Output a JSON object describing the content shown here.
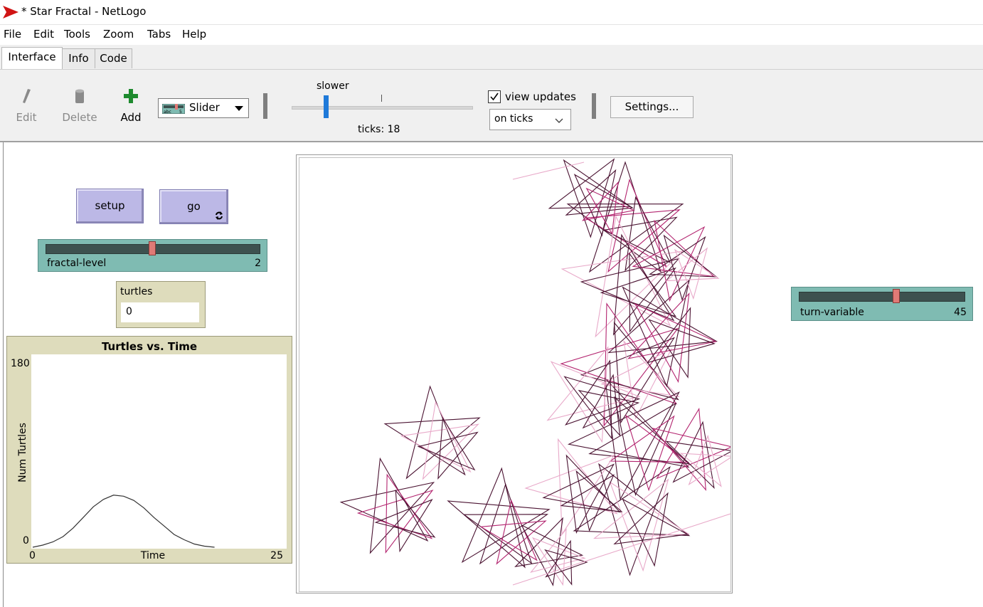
{
  "window": {
    "title": "* Star Fractal - NetLogo"
  },
  "menu": [
    "File",
    "Edit",
    "Tools",
    "Zoom",
    "Tabs",
    "Help"
  ],
  "tabs": [
    "Interface",
    "Info",
    "Code"
  ],
  "toolbar": {
    "edit_label": "Edit",
    "delete_label": "Delete",
    "add_label": "Add",
    "widget_type": "Slider",
    "speed_label": "slower",
    "ticks_text": "ticks: 18",
    "view_updates_label": "view updates",
    "view_updates_checked": true,
    "update_mode": "on ticks",
    "settings_label": "Settings..."
  },
  "buttons": {
    "setup": "setup",
    "go": "go"
  },
  "sliders": {
    "fractal_level": {
      "name": "fractal-level",
      "value": "2"
    },
    "turn_variable": {
      "name": "turn-variable",
      "value": "45"
    }
  },
  "monitor": {
    "name": "turtles",
    "value": "0"
  },
  "plot": {
    "title": "Turtles vs. Time",
    "xlabel": "Time",
    "ylabel": "Num Turtles",
    "xmin": "0",
    "xmax": "25",
    "ymin": "0",
    "ymax": "180"
  },
  "chart_data": {
    "type": "line",
    "title": "Turtles vs. Time",
    "xlabel": "Time",
    "ylabel": "Num Turtles",
    "xlim": [
      0,
      25
    ],
    "ylim": [
      0,
      180
    ],
    "series": [
      {
        "x": [
          0,
          1,
          2,
          3,
          4,
          5,
          6,
          7,
          8,
          9,
          10,
          11,
          12,
          13,
          14,
          15,
          16,
          17,
          18
        ],
        "values": [
          0,
          2,
          5,
          10,
          18,
          28,
          38,
          45,
          49,
          48,
          44,
          37,
          28,
          20,
          12,
          7,
          3,
          1,
          0
        ]
      }
    ]
  },
  "colors": {
    "button": "#bcb8e6",
    "slider": "#7fbbb2",
    "monitor": "#dedcbc",
    "line_dark": "#4a1231",
    "line_magenta": "#b3246f",
    "line_pink": "#e8a9c9"
  }
}
